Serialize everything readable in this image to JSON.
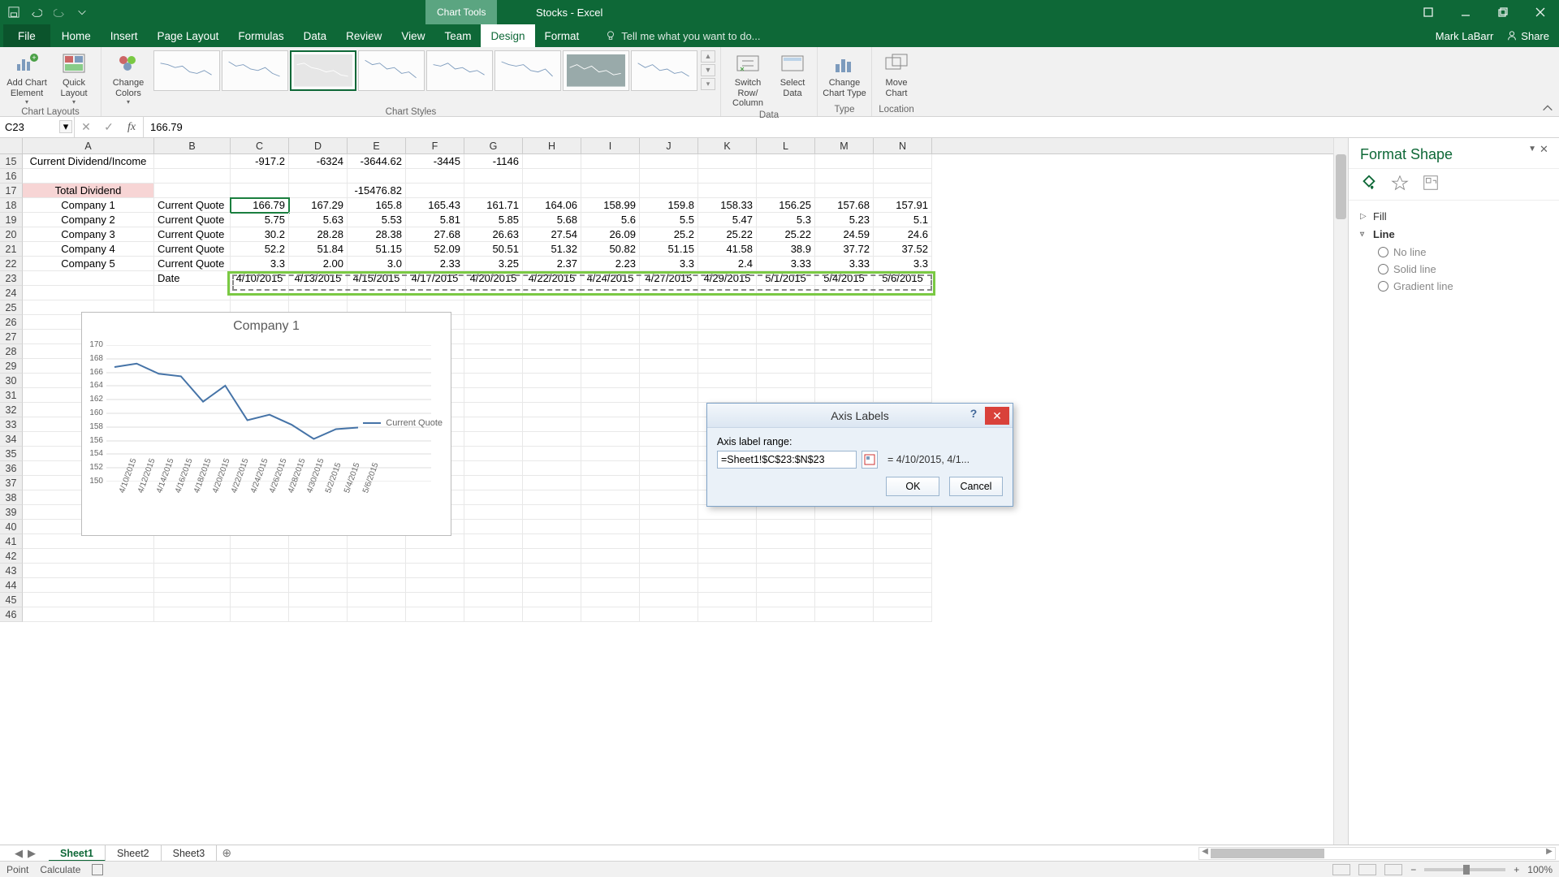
{
  "title_bar": {
    "chart_tools": "Chart Tools",
    "doc_title": "Stocks - Excel"
  },
  "ribbon": {
    "file": "File",
    "tabs": [
      "Home",
      "Insert",
      "Page Layout",
      "Formulas",
      "Data",
      "Review",
      "View",
      "Team",
      "Design",
      "Format"
    ],
    "active_tab": "Design",
    "tellme_placeholder": "Tell me what you want to do...",
    "user": "Mark LaBarr",
    "share": "Share",
    "groups": {
      "layouts": "Chart Layouts",
      "styles": "Chart Styles",
      "data": "Data",
      "type": "Type",
      "location": "Location"
    },
    "buttons": {
      "add_element": "Add Chart Element",
      "quick_layout": "Quick Layout",
      "change_colors": "Change Colors",
      "switch_row_col": "Switch Row/ Column",
      "select_data": "Select Data",
      "change_type": "Change Chart Type",
      "move_chart": "Move Chart"
    }
  },
  "formula_bar": {
    "name_box": "C23",
    "formula": "166.79"
  },
  "columns": [
    "A",
    "B",
    "C",
    "D",
    "E",
    "F",
    "G",
    "H",
    "I",
    "J",
    "K",
    "L",
    "M",
    "N"
  ],
  "header_rows_start": 15,
  "rows": [
    {
      "r": 15,
      "a": "Current Dividend/Income",
      "b": "",
      "vals": [
        "-917.2",
        "-6324",
        "-3644.62",
        "-3445",
        "-1146",
        "",
        "",
        "",
        "",
        "",
        "",
        ""
      ]
    },
    {
      "r": 16,
      "a": "",
      "b": "",
      "vals": [
        "",
        "",
        "",
        "",
        "",
        "",
        "",
        "",
        "",
        "",
        "",
        ""
      ]
    },
    {
      "r": 17,
      "a": "Total Dividend",
      "b": "",
      "vals": [
        "",
        "",
        "-15476.82",
        "",
        "",
        "",
        "",
        "",
        "",
        "",
        "",
        ""
      ],
      "a_style": "pink"
    },
    {
      "r": 18,
      "a": "Company 1",
      "b": "Current Quote",
      "vals": [
        "166.79",
        "167.29",
        "165.8",
        "165.43",
        "161.71",
        "164.06",
        "158.99",
        "159.8",
        "158.33",
        "156.25",
        "157.68",
        "157.91"
      ],
      "select_c": true
    },
    {
      "r": 19,
      "a": "Company 2",
      "b": "Current Quote",
      "vals": [
        "5.75",
        "5.63",
        "5.53",
        "5.81",
        "5.85",
        "5.68",
        "5.6",
        "5.5",
        "5.47",
        "5.3",
        "5.23",
        "5.1"
      ]
    },
    {
      "r": 20,
      "a": "Company 3",
      "b": "Current Quote",
      "vals": [
        "30.2",
        "28.28",
        "28.38",
        "27.68",
        "26.63",
        "27.54",
        "26.09",
        "25.2",
        "25.22",
        "25.22",
        "24.59",
        "24.6"
      ]
    },
    {
      "r": 21,
      "a": "Company 4",
      "b": "Current Quote",
      "vals": [
        "52.2",
        "51.84",
        "51.15",
        "52.09",
        "50.51",
        "51.32",
        "50.82",
        "51.15",
        "41.58",
        "38.9",
        "37.72",
        "37.52"
      ]
    },
    {
      "r": 22,
      "a": "Company 5",
      "b": "Current Quote",
      "vals": [
        "3.3",
        "2.00",
        "3.0",
        "2.33",
        "3.25",
        "2.37",
        "2.23",
        "3.3",
        "2.4",
        "3.33",
        "3.33",
        "3.3"
      ]
    },
    {
      "r": 23,
      "a": "",
      "b": "Date",
      "vals": [
        "4/10/2015",
        "4/13/2015",
        "4/15/2015",
        "4/17/2015",
        "4/20/2015",
        "4/22/2015",
        "4/24/2015",
        "4/27/2015",
        "4/29/2015",
        "5/1/2015",
        "5/4/2015",
        "5/6/2015"
      ]
    }
  ],
  "empty_rows": [
    24,
    25,
    26,
    27,
    28,
    29,
    30,
    31,
    32,
    33,
    34,
    35,
    36,
    37,
    38,
    39,
    40,
    41,
    42,
    43,
    44,
    45,
    46
  ],
  "chart_data": {
    "type": "line",
    "title": "Company 1",
    "series": [
      {
        "name": "Current Quote",
        "values": [
          166.79,
          167.29,
          165.8,
          165.43,
          161.71,
          164.06,
          158.99,
          159.8,
          158.33,
          156.25,
          157.68,
          157.91
        ]
      }
    ],
    "x_labels": [
      "4/10/2015",
      "4/12/2015",
      "4/14/2015",
      "4/16/2015",
      "4/18/2015",
      "4/20/2015",
      "4/22/2015",
      "4/24/2015",
      "4/26/2015",
      "4/28/2015",
      "4/30/2015",
      "5/2/2015",
      "5/4/2015",
      "5/6/2015"
    ],
    "y_ticks": [
      150,
      152,
      154,
      156,
      158,
      160,
      162,
      164,
      166,
      168,
      170
    ],
    "ylim": [
      150,
      170
    ],
    "legend": "Current Quote"
  },
  "dialog": {
    "title": "Axis Labels",
    "field_label": "Axis label range:",
    "value": "=Sheet1!$C$23:$N$23",
    "preview": "= 4/10/2015, 4/1...",
    "ok": "OK",
    "cancel": "Cancel"
  },
  "format_pane": {
    "title": "Format Shape",
    "fill": "Fill",
    "line": "Line",
    "opts": [
      "No line",
      "Solid line",
      "Gradient line"
    ]
  },
  "sheet_tabs": [
    "Sheet1",
    "Sheet2",
    "Sheet3"
  ],
  "status": {
    "mode": "Point",
    "calc": "Calculate",
    "zoom": "100%"
  }
}
